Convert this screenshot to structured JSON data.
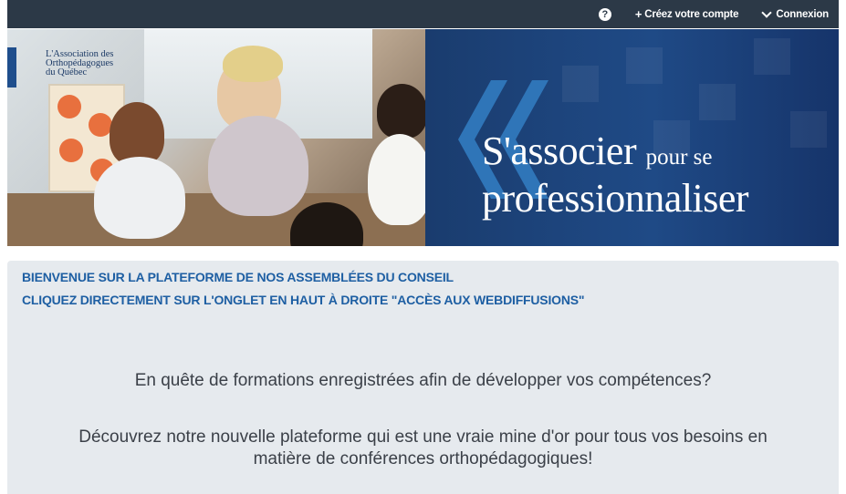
{
  "topbar": {
    "help_icon": "question-circle-icon",
    "create_account_label": "Créez votre compte",
    "create_icon": "plus-icon",
    "login_label": "Connexion",
    "login_icon": "chevron-down-icon"
  },
  "banner": {
    "logo_line1": "L'Association des",
    "logo_line2": "Orthopédagogues",
    "logo_line3": "du Québec",
    "slogan_word1": "S'associer",
    "slogan_word2": "pour se",
    "slogan_word3": "professionnaliser",
    "colors": {
      "panel": "#1f4a86",
      "arrows": "#2f75b8"
    }
  },
  "content": {
    "heading1": "BIENVENUE SUR LA PLATEFORME DE NOS ASSEMBLÉES DU CONSEIL",
    "heading2": "CLIQUEZ DIRECTEMENT SUR L'ONGLET  EN HAUT À DROITE \"ACCÈS AUX WEBDIFFUSIONS\"",
    "paragraph1": "En quête de formations enregistrées afin de développer vos compétences?",
    "paragraph2_line1": "Découvrez notre nouvelle plateforme qui est une vraie mine d'or pour tous vos besoins en",
    "paragraph2_line2": "matière de conférences orthopédagogiques!",
    "colors": {
      "heading": "#1e5fa3",
      "text": "#3b4048",
      "background": "#e6eaee"
    }
  }
}
